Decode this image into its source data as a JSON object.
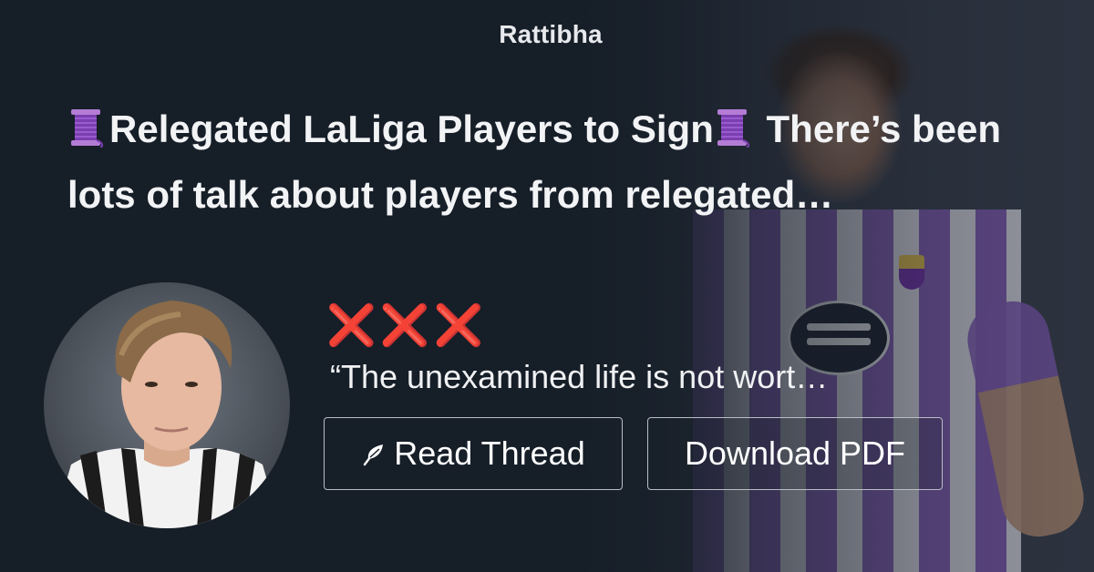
{
  "brand": {
    "name": "Rattibha"
  },
  "thread": {
    "title_part1": "Relegated LaLiga Players to Sign",
    "title_part2": " There’s been lots of talk about players from relegated…"
  },
  "author": {
    "name": "❌❌❌",
    "bio": "“The unexamined life is not wort…"
  },
  "actions": {
    "read_label": "Read Thread",
    "pdf_label": "Download PDF"
  },
  "colors": {
    "background": "#161e28",
    "accent_red": "#e5304d",
    "text": "#ffffff"
  },
  "icons": {
    "title": "spool-of-thread-icon",
    "read_button": "feather-icon"
  }
}
